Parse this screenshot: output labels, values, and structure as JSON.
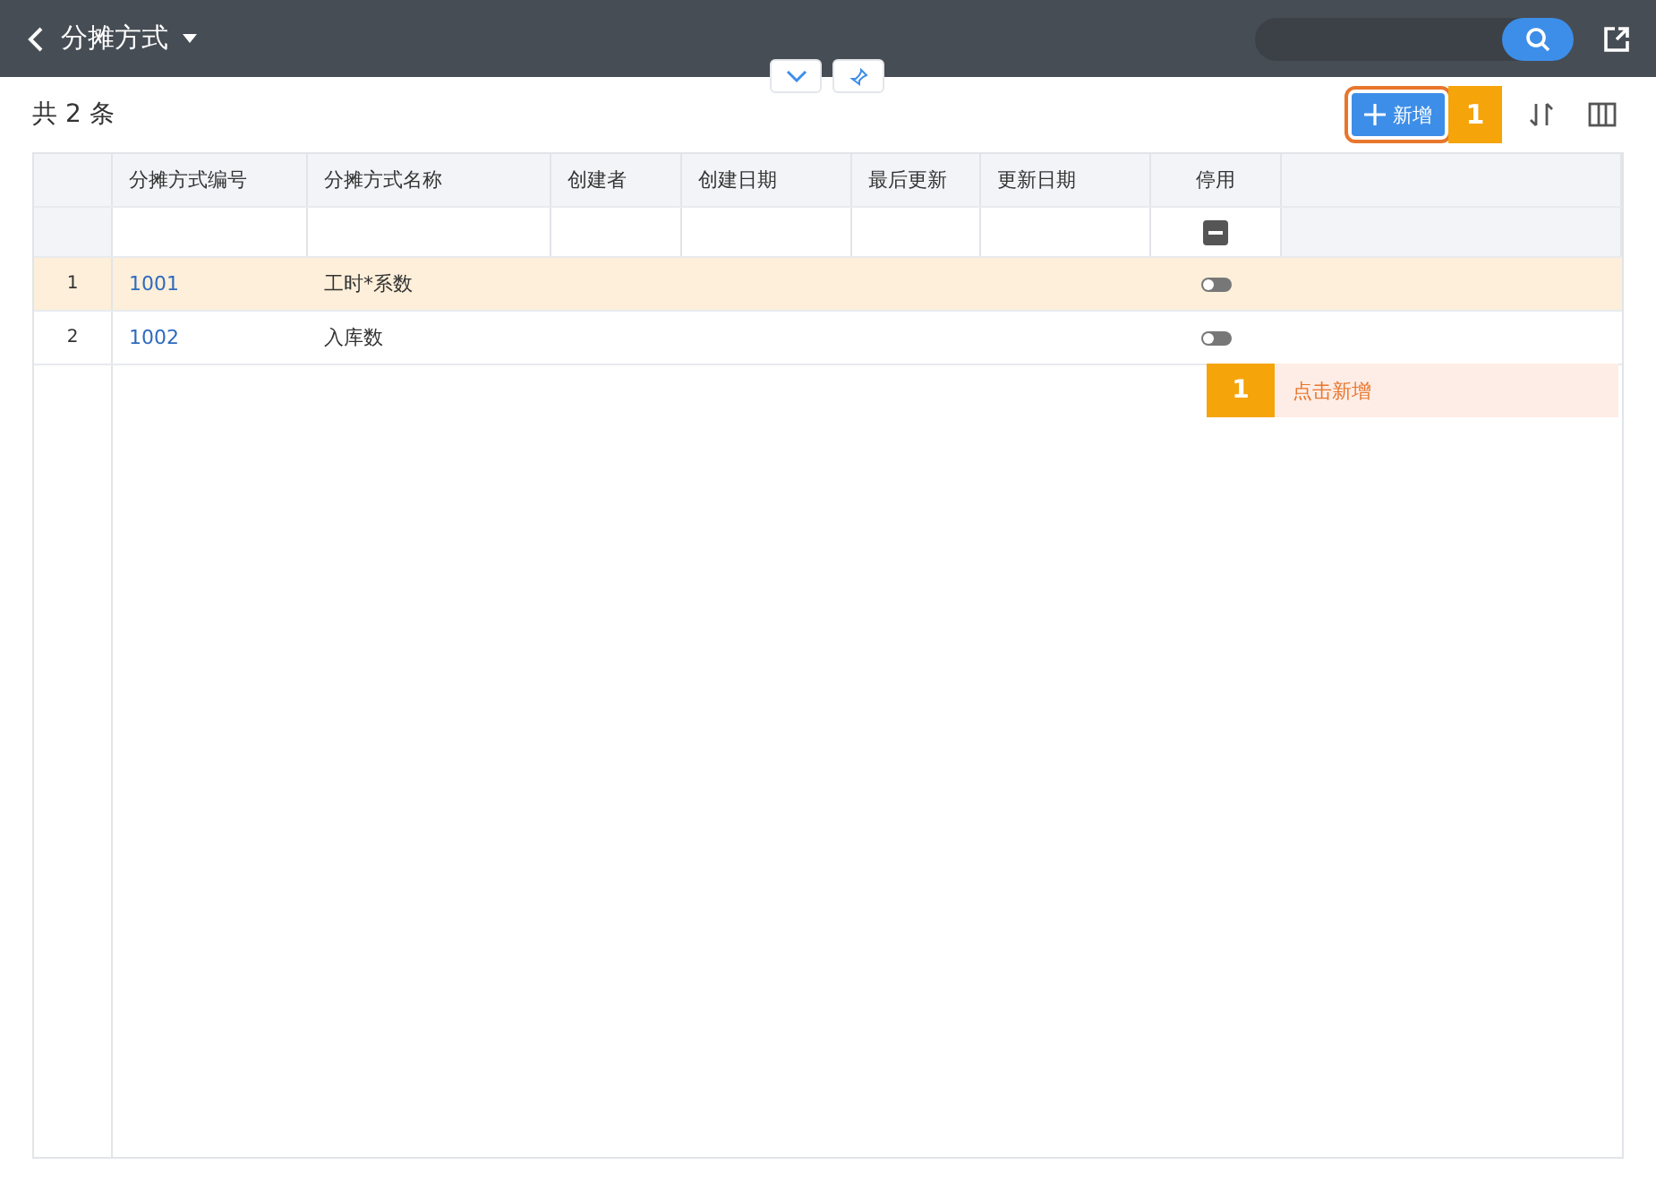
{
  "header": {
    "title": "分摊方式"
  },
  "count": "共 2 条",
  "toolbar": {
    "add_button": "新增",
    "step_badge": "1"
  },
  "table": {
    "columns": [
      "分摊方式编号",
      "分摊方式名称",
      "创建者",
      "创建日期",
      "最后更新",
      "更新日期",
      "停用"
    ],
    "rows": [
      {
        "index": "1",
        "code": "1001",
        "name": "工时*系数",
        "disabled": false,
        "selected": true
      },
      {
        "index": "2",
        "code": "1002",
        "name": "入库数",
        "disabled": false,
        "selected": false
      }
    ]
  },
  "guide": {
    "step": "1",
    "text": "点击新增"
  }
}
